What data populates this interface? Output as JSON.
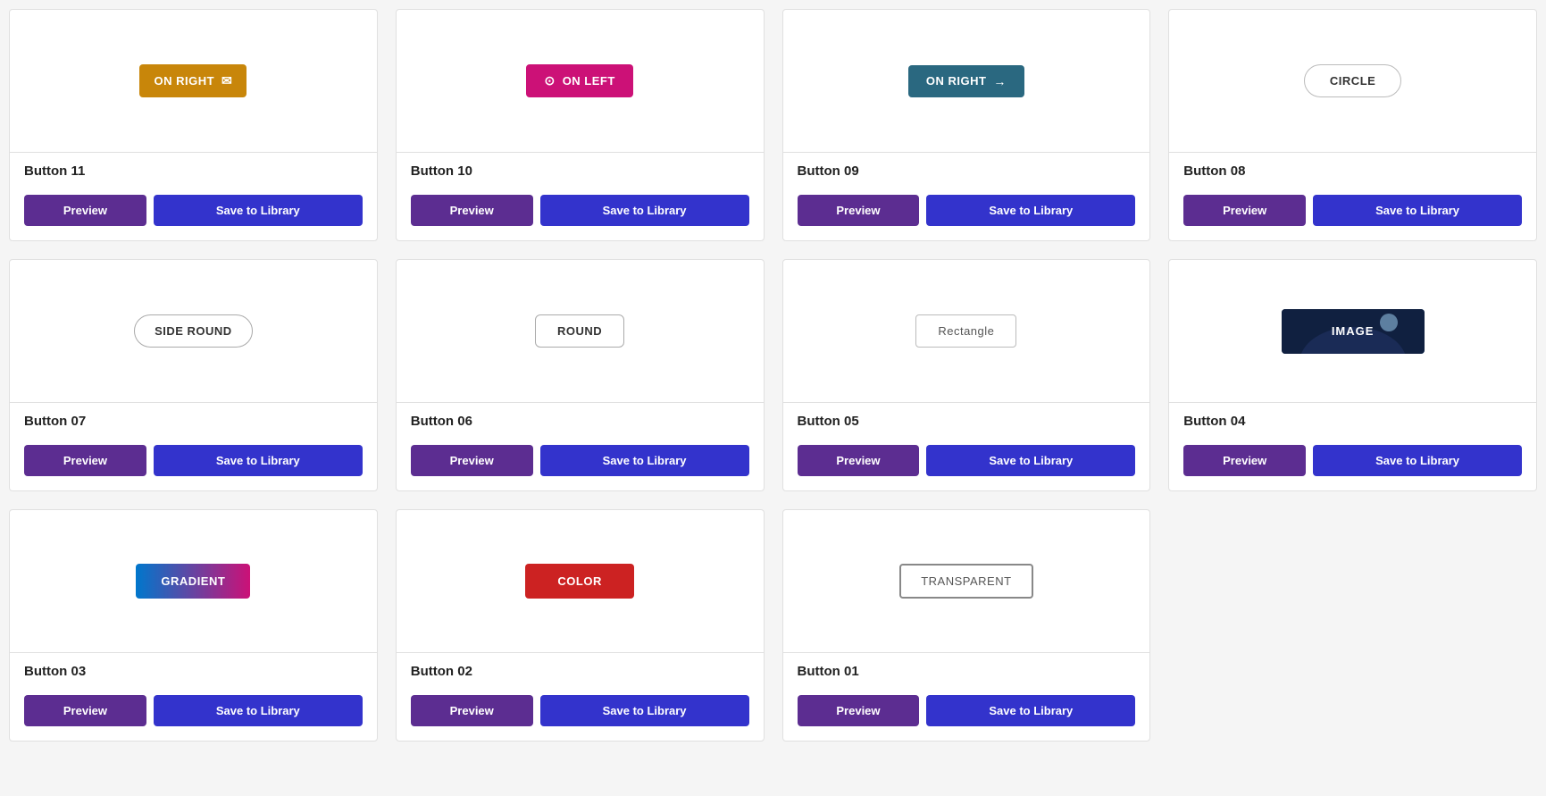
{
  "cards": [
    {
      "id": "btn11",
      "title": "Button 11",
      "previewType": "amber-right",
      "previewLabel": "ON RIGHT",
      "previewIcon": "envelope",
      "actionPreview": "Preview",
      "actionSave": "Save to Library"
    },
    {
      "id": "btn10",
      "title": "Button 10",
      "previewType": "pink-left",
      "previewLabel": "ON LEFT",
      "previewIcon": "play-left",
      "actionPreview": "Preview",
      "actionSave": "Save to Library"
    },
    {
      "id": "btn09",
      "title": "Button 09",
      "previewType": "teal-right",
      "previewLabel": "ON RIGHT",
      "previewIcon": "arrow",
      "actionPreview": "Preview",
      "actionSave": "Save to Library"
    },
    {
      "id": "btn08",
      "title": "Button 08",
      "previewType": "circle-outline",
      "previewLabel": "CIRCLE",
      "actionPreview": "Preview",
      "actionSave": "Save to Library"
    },
    {
      "id": "btn07",
      "title": "Button 07",
      "previewType": "side-round",
      "previewLabel": "SIDE ROUND",
      "actionPreview": "Preview",
      "actionSave": "Save to Library"
    },
    {
      "id": "btn06",
      "title": "Button 06",
      "previewType": "round",
      "previewLabel": "ROUND",
      "actionPreview": "Preview",
      "actionSave": "Save to Library"
    },
    {
      "id": "btn05",
      "title": "Button 05",
      "previewType": "rectangle",
      "previewLabel": "Rectangle",
      "actionPreview": "Preview",
      "actionSave": "Save to Library"
    },
    {
      "id": "btn04",
      "title": "Button 04",
      "previewType": "image",
      "previewLabel": "IMAGE",
      "actionPreview": "Preview",
      "actionSave": "Save to Library"
    },
    {
      "id": "btn03",
      "title": "Button 03",
      "previewType": "gradient",
      "previewLabel": "GRADIENT",
      "actionPreview": "Preview",
      "actionSave": "Save to Library"
    },
    {
      "id": "btn02",
      "title": "Button 02",
      "previewType": "color",
      "previewLabel": "COLOR",
      "actionPreview": "Preview",
      "actionSave": "Save to Library"
    },
    {
      "id": "btn01",
      "title": "Button 01",
      "previewType": "transparent",
      "previewLabel": "TRANSPARENT",
      "actionPreview": "Preview",
      "actionSave": "Save to Library"
    }
  ]
}
